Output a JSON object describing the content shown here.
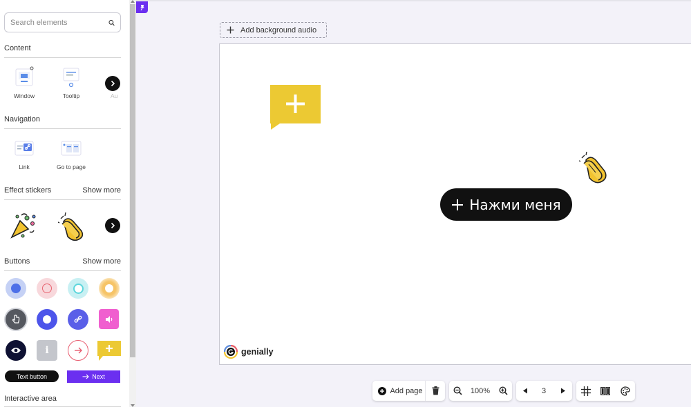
{
  "search": {
    "placeholder": "Search elements"
  },
  "sections": {
    "content": {
      "title": "Content",
      "items": [
        "Window",
        "Tooltip",
        "Au"
      ]
    },
    "navigation": {
      "title": "Navigation",
      "items": [
        "Link",
        "Go to page"
      ]
    },
    "effect_stickers": {
      "title": "Effect stickers",
      "show_more": "Show more"
    },
    "buttons": {
      "title": "Buttons",
      "show_more": "Show more",
      "text_button": "Text button",
      "next_button": "Next"
    },
    "interactive_area": {
      "title": "Interactive area"
    }
  },
  "canvas": {
    "audio_label": "Add background audio",
    "pill_text": "Нажми меня",
    "brand": "genially"
  },
  "toolbar": {
    "add_page": "Add page",
    "zoom": "100%",
    "page_number": "3"
  },
  "colors": {
    "accent": "#6b2ff0",
    "bubble": "#ecc933",
    "dark": "#111111"
  }
}
